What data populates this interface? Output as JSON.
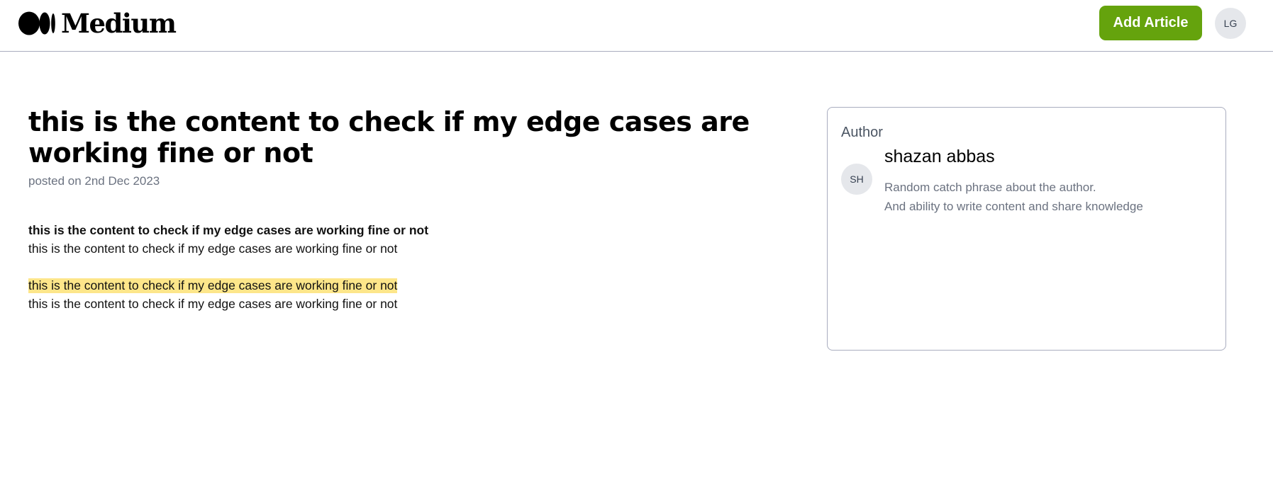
{
  "header": {
    "logo_text": "Medium",
    "add_article_label": "Add Article",
    "user_initials": "LG",
    "accent_color": "#65a30d"
  },
  "article": {
    "title": "this is the content to check if my edge cases are working fine or not",
    "posted": "posted on 2nd Dec 2023",
    "paragraphs": [
      "this is the content to check if my edge cases are working fine or not",
      "this is the content to check if my edge cases are working fine or not",
      "this is the content to check if my edge cases are working fine or not",
      "this is the content to check if my edge cases are working fine or not"
    ],
    "highlight_color": "#fde68a"
  },
  "author_card": {
    "label": "Author",
    "initials": "SH",
    "name": "shazan abbas",
    "bio_line1": "Random catch phrase about the author.",
    "bio_line2": "And ability to write content and share knowledge"
  }
}
